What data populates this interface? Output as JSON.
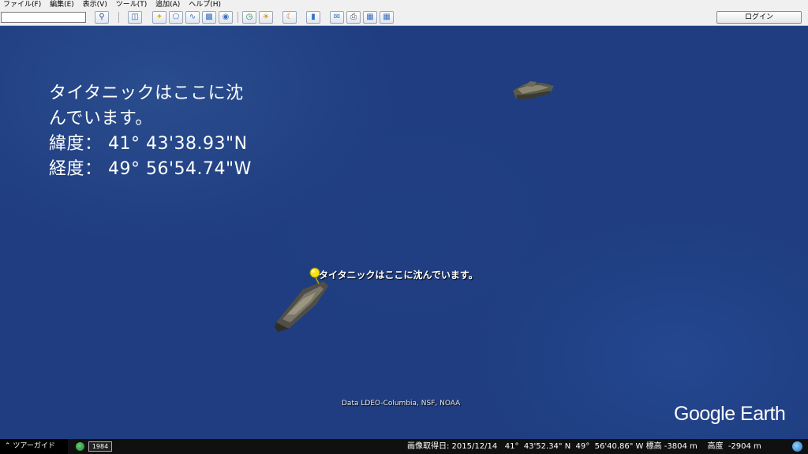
{
  "menubar": {
    "items": [
      "ファイル(F)",
      "編集(E)",
      "表示(V)",
      "ツール(T)",
      "追加(A)",
      "ヘルプ(H)"
    ]
  },
  "toolbar": {
    "search_value": "",
    "login_label": "ログイン"
  },
  "overlay": {
    "lines": [
      "タイタニックはここに沈",
      "んでいます。",
      "緯度： 41°  43'38.93\"N",
      "経度： 49°  56'54.74\"W"
    ]
  },
  "placemark": {
    "label": "タイタニックはここに沈んでいます。"
  },
  "credit": "Data LDEO-Columbia, NSF, NOAA",
  "logo": "Google Earth",
  "statusbar": {
    "tour_guide": "ツアーガイド",
    "year": "1984",
    "imagery_date": "画像取得日: 2015/12/14",
    "lat": "41°  43'52.34\" N",
    "lon": "49°  56'40.86\" W",
    "elevation": "標高 -3804 m",
    "altitude": "高度  -2904 m"
  },
  "colors": {
    "ocean": "#1f3d80",
    "pin": "#f5e31a"
  }
}
